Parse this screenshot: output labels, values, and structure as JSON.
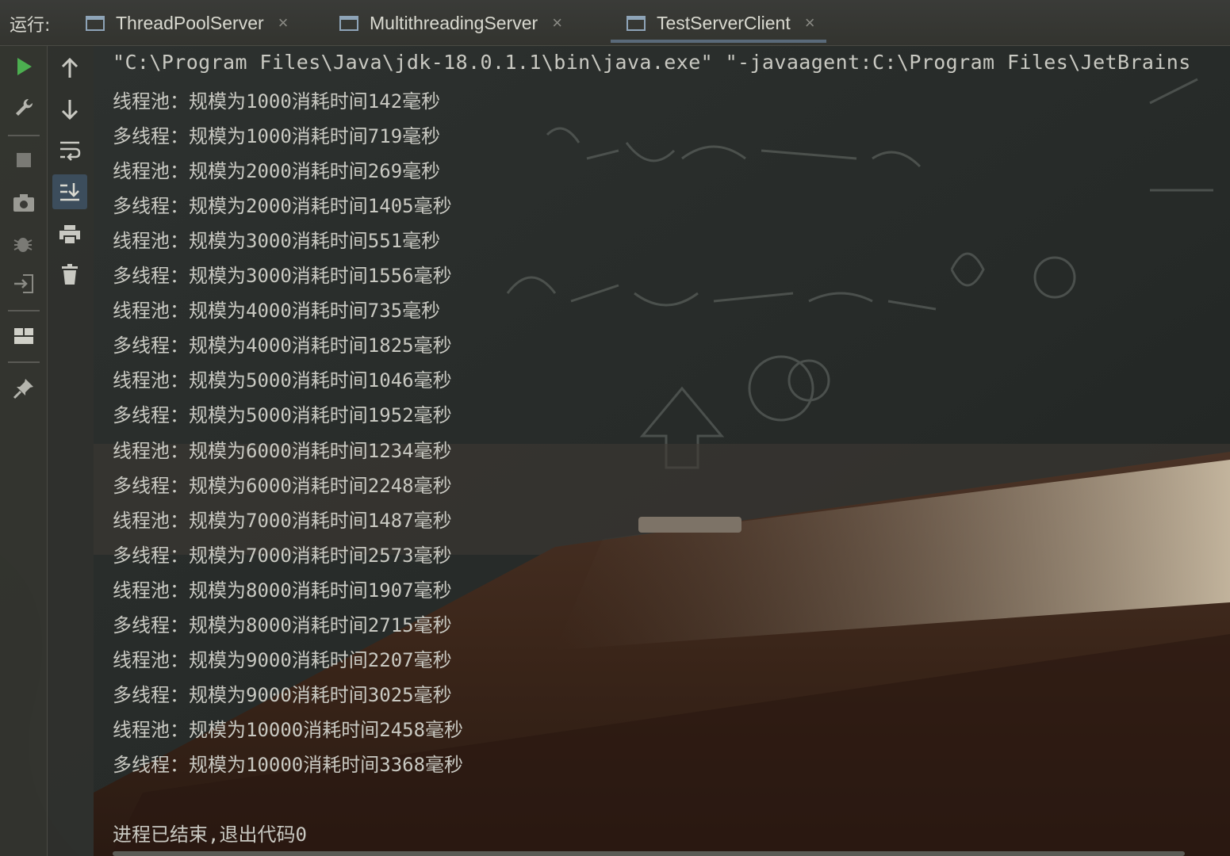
{
  "window": {
    "run_label": "运行:",
    "tabs": [
      {
        "label": "ThreadPoolServer",
        "close": "×",
        "active": false
      },
      {
        "label": "MultithreadingServer",
        "close": "×",
        "active": false
      },
      {
        "label": "TestServerClient",
        "close": "×",
        "active": true
      }
    ]
  },
  "toolbar_left": {
    "icons": [
      "run-icon",
      "wrench-icon",
      "stop-icon",
      "camera-icon",
      "debug-bug-icon",
      "login-icon",
      "layout-icon",
      "pin-icon"
    ]
  },
  "toolbar_right": {
    "icons": [
      "arrow-up-icon",
      "arrow-down-icon",
      "soft-wrap-icon",
      "scroll-to-end-icon",
      "print-icon",
      "trash-icon"
    ]
  },
  "console": {
    "command": "\"C:\\Program Files\\Java\\jdk-18.0.1.1\\bin\\java.exe\" \"-javaagent:C:\\Program Files\\JetBrains",
    "lines": [
      "线程池：规模为1000消耗时间142毫秒",
      "多线程：规模为1000消耗时间719毫秒",
      "线程池：规模为2000消耗时间269毫秒",
      "多线程：规模为2000消耗时间1405毫秒",
      "线程池：规模为3000消耗时间551毫秒",
      "多线程：规模为3000消耗时间1556毫秒",
      "线程池：规模为4000消耗时间735毫秒",
      "多线程：规模为4000消耗时间1825毫秒",
      "线程池：规模为5000消耗时间1046毫秒",
      "多线程：规模为5000消耗时间1952毫秒",
      "线程池：规模为6000消耗时间1234毫秒",
      "多线程：规模为6000消耗时间2248毫秒",
      "线程池：规模为7000消耗时间1487毫秒",
      "多线程：规模为7000消耗时间2573毫秒",
      "线程池：规模为8000消耗时间1907毫秒",
      "多线程：规模为8000消耗时间2715毫秒",
      "线程池：规模为9000消耗时间2207毫秒",
      "多线程：规模为9000消耗时间3025毫秒",
      "线程池：规模为10000消耗时间2458毫秒",
      "多线程：规模为10000消耗时间3368毫秒"
    ],
    "exit_message": "进程已结束,退出代码0"
  },
  "colors": {
    "run_green": "#4caf50",
    "console_text": "#c9c9c2",
    "selected_tool": "#3c4d5c"
  }
}
